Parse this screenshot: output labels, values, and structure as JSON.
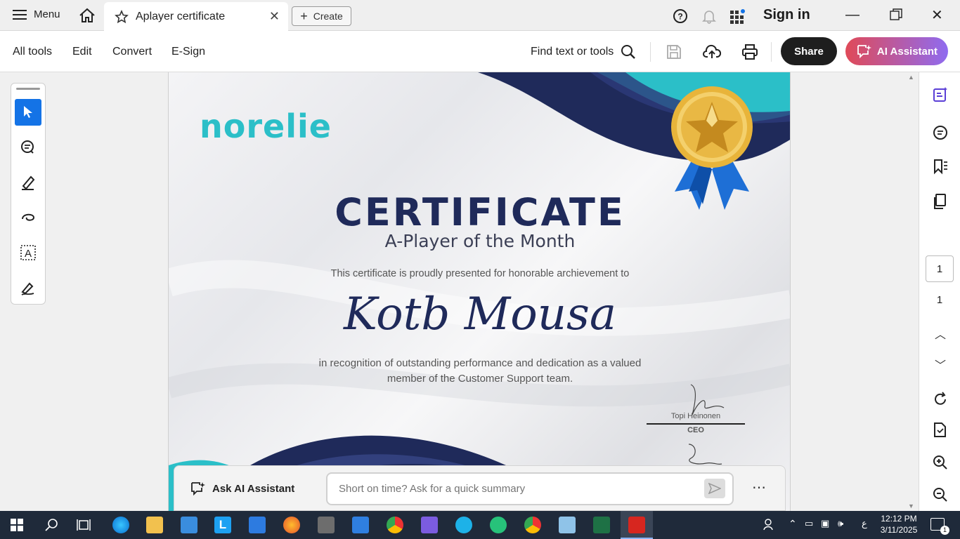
{
  "titlebar": {
    "menu_label": "Menu",
    "tab_title": "Aplayer certificate",
    "create_label": "Create",
    "sign_in": "Sign in"
  },
  "toolbar": {
    "items": [
      "All tools",
      "Edit",
      "Convert",
      "E-Sign"
    ],
    "find_label": "Find text or tools",
    "share_label": "Share",
    "ai_assistant_label": "AI Assistant"
  },
  "certificate": {
    "brand": "norelie",
    "title": "CERTIFICATE",
    "subtitle": "A-Player of the Month",
    "presented_text": "This certificate is proudly presented for honorable archievement to",
    "recipient": "Kotb Mousa",
    "recognition_line1": "in recognition of outstanding performance and dedication as a valued",
    "recognition_line2": "member of the Customer Support team.",
    "signer_name": "Topi Heinonen",
    "signer_title": "CEO"
  },
  "rightrail": {
    "page_current": "1",
    "page_total": "1"
  },
  "ai_bar": {
    "label": "Ask AI Assistant",
    "placeholder": "Short on time? Ask for a quick summary",
    "more": "⋯"
  },
  "taskbar": {
    "time": "12:12 PM",
    "date": "3/11/2025",
    "lang": "ع",
    "notification_count": "1"
  },
  "colors": {
    "navy": "#1f2a5a",
    "teal": "#2bbfc8",
    "accent_blue": "#1473e6"
  }
}
